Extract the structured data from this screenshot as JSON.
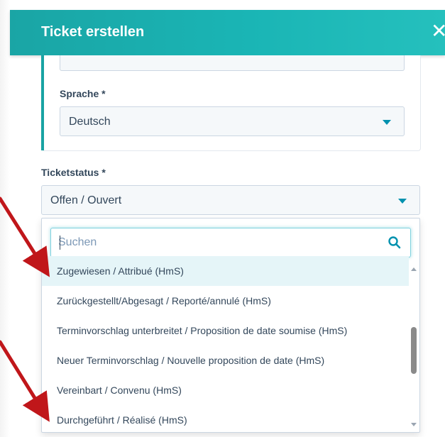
{
  "dialog": {
    "title": "Ticket erstellen",
    "close_label": "✕"
  },
  "fields": {
    "language": {
      "label": "Sprache *",
      "value": "Deutsch"
    },
    "ticket_status": {
      "label": "Ticketstatus *",
      "value": "Offen / Ouvert"
    }
  },
  "dropdown": {
    "search_placeholder": "Suchen",
    "options": [
      "Zugewiesen / Attribué (HmS)",
      "Zurückgestellt/Abgesagt / Reporté/annulé (HmS)",
      "Terminvorschlag unterbreitet / Proposition de date soumise (HmS)",
      "Neuer Terminvorschlag / Nouvelle proposition de date (HmS)",
      "Vereinbart / Convenu (HmS)",
      "Durchgeführt / Réalisé (HmS)"
    ],
    "highlighted_option": "Zugewiesen / Attribué (HmS)"
  },
  "colors": {
    "header": "#1aa5a5",
    "accent": "#0091ae",
    "annotation_arrow": "#c0161a"
  },
  "icons": {
    "close": "close-icon",
    "caret": "chevron-down-icon",
    "search": "search-icon"
  }
}
